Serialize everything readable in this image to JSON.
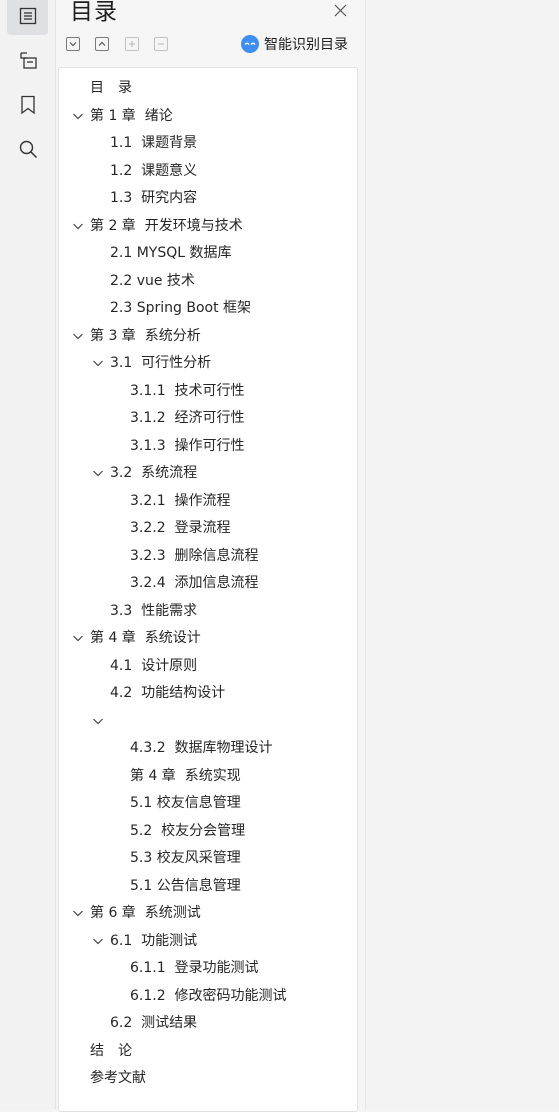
{
  "panel": {
    "title": "目录",
    "smart_label": "智能识别目录"
  },
  "toc": [
    {
      "label": "目　录",
      "level": 0,
      "expand": false
    },
    {
      "label": "第 1 章  绪论",
      "level": 0,
      "expand": true
    },
    {
      "label": "1.1  课题背景",
      "level": 1,
      "expand": false
    },
    {
      "label": "1.2  课题意义",
      "level": 1,
      "expand": false
    },
    {
      "label": "1.3  研究内容",
      "level": 1,
      "expand": false
    },
    {
      "label": "第 2 章  开发环境与技术",
      "level": 0,
      "expand": true
    },
    {
      "label": "2.1 MYSQL 数据库",
      "level": 1,
      "expand": false
    },
    {
      "label": "2.2 vue 技术",
      "level": 1,
      "expand": false
    },
    {
      "label": "2.3 Spring Boot 框架",
      "level": 1,
      "expand": false
    },
    {
      "label": "第 3 章  系统分析",
      "level": 0,
      "expand": true
    },
    {
      "label": "3.1  可行性分析",
      "level": 1,
      "expand": true
    },
    {
      "label": "3.1.1  技术可行性",
      "level": 2,
      "expand": false
    },
    {
      "label": "3.1.2  经济可行性",
      "level": 2,
      "expand": false
    },
    {
      "label": "3.1.3  操作可行性",
      "level": 2,
      "expand": false
    },
    {
      "label": "3.2  系统流程",
      "level": 1,
      "expand": true
    },
    {
      "label": "3.2.1  操作流程",
      "level": 2,
      "expand": false
    },
    {
      "label": "3.2.2  登录流程",
      "level": 2,
      "expand": false
    },
    {
      "label": "3.2.3  删除信息流程",
      "level": 2,
      "expand": false
    },
    {
      "label": "3.2.4  添加信息流程",
      "level": 2,
      "expand": false
    },
    {
      "label": "3.3  性能需求",
      "level": 1,
      "expand": false
    },
    {
      "label": "第 4 章  系统设计",
      "level": 0,
      "expand": true
    },
    {
      "label": "4.1  设计原则",
      "level": 1,
      "expand": false
    },
    {
      "label": "4.2  功能结构设计",
      "level": 1,
      "expand": false
    },
    {
      "label": "",
      "level": 1,
      "expand": true
    },
    {
      "label": "4.3.2  数据库物理设计",
      "level": 2,
      "expand": false
    },
    {
      "label": "第 4 章  系统实现",
      "level": 2,
      "expand": false
    },
    {
      "label": "5.1 校友信息管理",
      "level": 2,
      "expand": false
    },
    {
      "label": "5.2  校友分会管理",
      "level": 2,
      "expand": false
    },
    {
      "label": "5.3 校友风采管理",
      "level": 2,
      "expand": false
    },
    {
      "label": "5.1 公告信息管理",
      "level": 2,
      "expand": false
    },
    {
      "label": "第 6 章  系统测试",
      "level": 0,
      "expand": true
    },
    {
      "label": "6.1  功能测试",
      "level": 1,
      "expand": true
    },
    {
      "label": "6.1.1  登录功能测试",
      "level": 2,
      "expand": false
    },
    {
      "label": "6.1.2  修改密码功能测试",
      "level": 2,
      "expand": false
    },
    {
      "label": "6.2  测试结果",
      "level": 1,
      "expand": false
    },
    {
      "label": "结　论",
      "level": 0,
      "expand": false
    },
    {
      "label": "参考文献",
      "level": 0,
      "expand": false
    }
  ],
  "icons": {
    "rail": [
      "toc-icon",
      "annotation-icon",
      "bookmark-icon",
      "search-icon"
    ],
    "toolbar": [
      "expand-all-icon",
      "collapse-all-icon",
      "add-icon",
      "remove-icon"
    ]
  },
  "colors": {
    "accent": "#3c8ef3"
  }
}
